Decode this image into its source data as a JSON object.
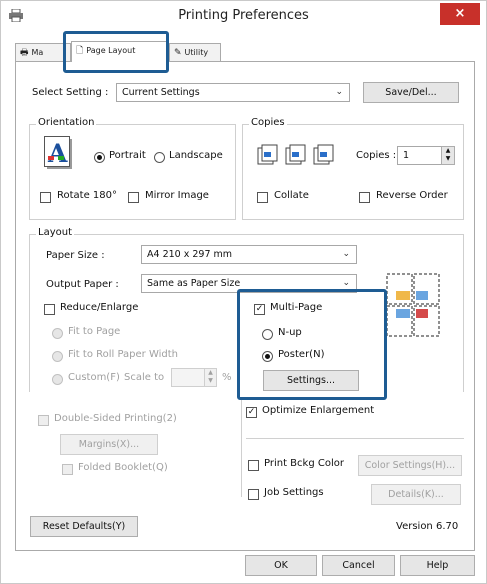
{
  "window": {
    "title": "Printing Preferences",
    "close_glyph": "×"
  },
  "tabs": [
    {
      "label": "Ma",
      "icon": "printer-icon"
    },
    {
      "label": "Page Layout",
      "icon": "page-icon"
    },
    {
      "label": "Utility",
      "icon": "wrench-icon"
    }
  ],
  "select_setting": {
    "label": "Select Setting :",
    "value": "Current Settings",
    "save_button": "Save/Del..."
  },
  "orientation": {
    "group_label": "Orientation",
    "portrait": "Portrait",
    "landscape": "Landscape",
    "rotate": "Rotate 180°",
    "mirror": "Mirror Image",
    "selected": "Portrait"
  },
  "copies": {
    "group_label": "Copies",
    "label": "Copies :",
    "value": "1",
    "collate": "Collate",
    "reverse": "Reverse Order"
  },
  "layout": {
    "group_label": "Layout",
    "paper_size_label": "Paper Size :",
    "paper_size_value": "A4 210 x 297 mm",
    "output_paper_label": "Output Paper :",
    "output_paper_value": "Same as Paper Size",
    "reduce_enlarge": "Reduce/Enlarge",
    "fit_to_page": "Fit to Page",
    "fit_to_roll": "Fit to Roll Paper Width",
    "custom": "Custom(F)",
    "scale_to": "Scale to",
    "scale_unit": "%",
    "multi_page": "Multi-Page",
    "multi_page_checked": true,
    "n_up": "N-up",
    "poster": "Poster(N)",
    "settings_button": "Settings...",
    "optimize": "Optimize Enlargement",
    "optimize_checked": true
  },
  "double_sided": {
    "label": "Double-Sided Printing(2)",
    "margins_button": "Margins(X)...",
    "folded_booklet": "Folded Booklet(Q)"
  },
  "print_bckg": {
    "label": "Print Bckg Color",
    "button": "Color Settings(H)..."
  },
  "job_settings": {
    "label": "Job Settings",
    "button": "Details(K)..."
  },
  "reset_button": "Reset Defaults(Y)",
  "version": "Version 6.70",
  "footer": {
    "ok": "OK",
    "cancel": "Cancel",
    "help": "Help"
  },
  "colors": {
    "highlight": "#1e5c93",
    "close": "#c8302a"
  }
}
